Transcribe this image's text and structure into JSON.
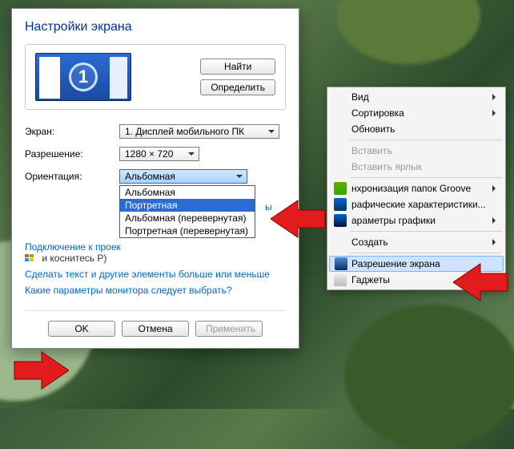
{
  "dialog": {
    "title": "Настройки экрана",
    "monitor_number": "1",
    "find_button": "Найти",
    "identify_button": "Определить",
    "screen_label": "Экран:",
    "screen_value": "1. Дисплей мобильного ПК",
    "resolution_label": "Разрешение:",
    "resolution_value": "1280 × 720",
    "orientation_label": "Ориентация:",
    "orientation_value": "Альбомная",
    "orientation_options": [
      "Альбомная",
      "Портретная",
      "Альбомная (перевернутая)",
      "Портретная (перевернутая)"
    ],
    "projector_link": "Подключение к проек",
    "projector_hint": "и коснитесь P)",
    "text_size_link": "Сделать текст и другие элементы больше или меньше",
    "monitor_help_link": "Какие параметры монитора следует выбрать?",
    "truncated_char": "ы",
    "ok_button": "OK",
    "cancel_button": "Отмена",
    "apply_button": "Применить"
  },
  "context_menu": {
    "view": "Вид",
    "sort": "Сортировка",
    "refresh": "Обновить",
    "paste": "Вставить",
    "paste_shortcut": "Вставить ярлык",
    "groove_sync": "нхронизация папок Groove",
    "graphics_props": "рафические характеристики...",
    "graphics_options": "араметры графики",
    "create": "Создать",
    "screen_resolution": "Разрешение экрана",
    "gadgets": "Гаджеты"
  }
}
